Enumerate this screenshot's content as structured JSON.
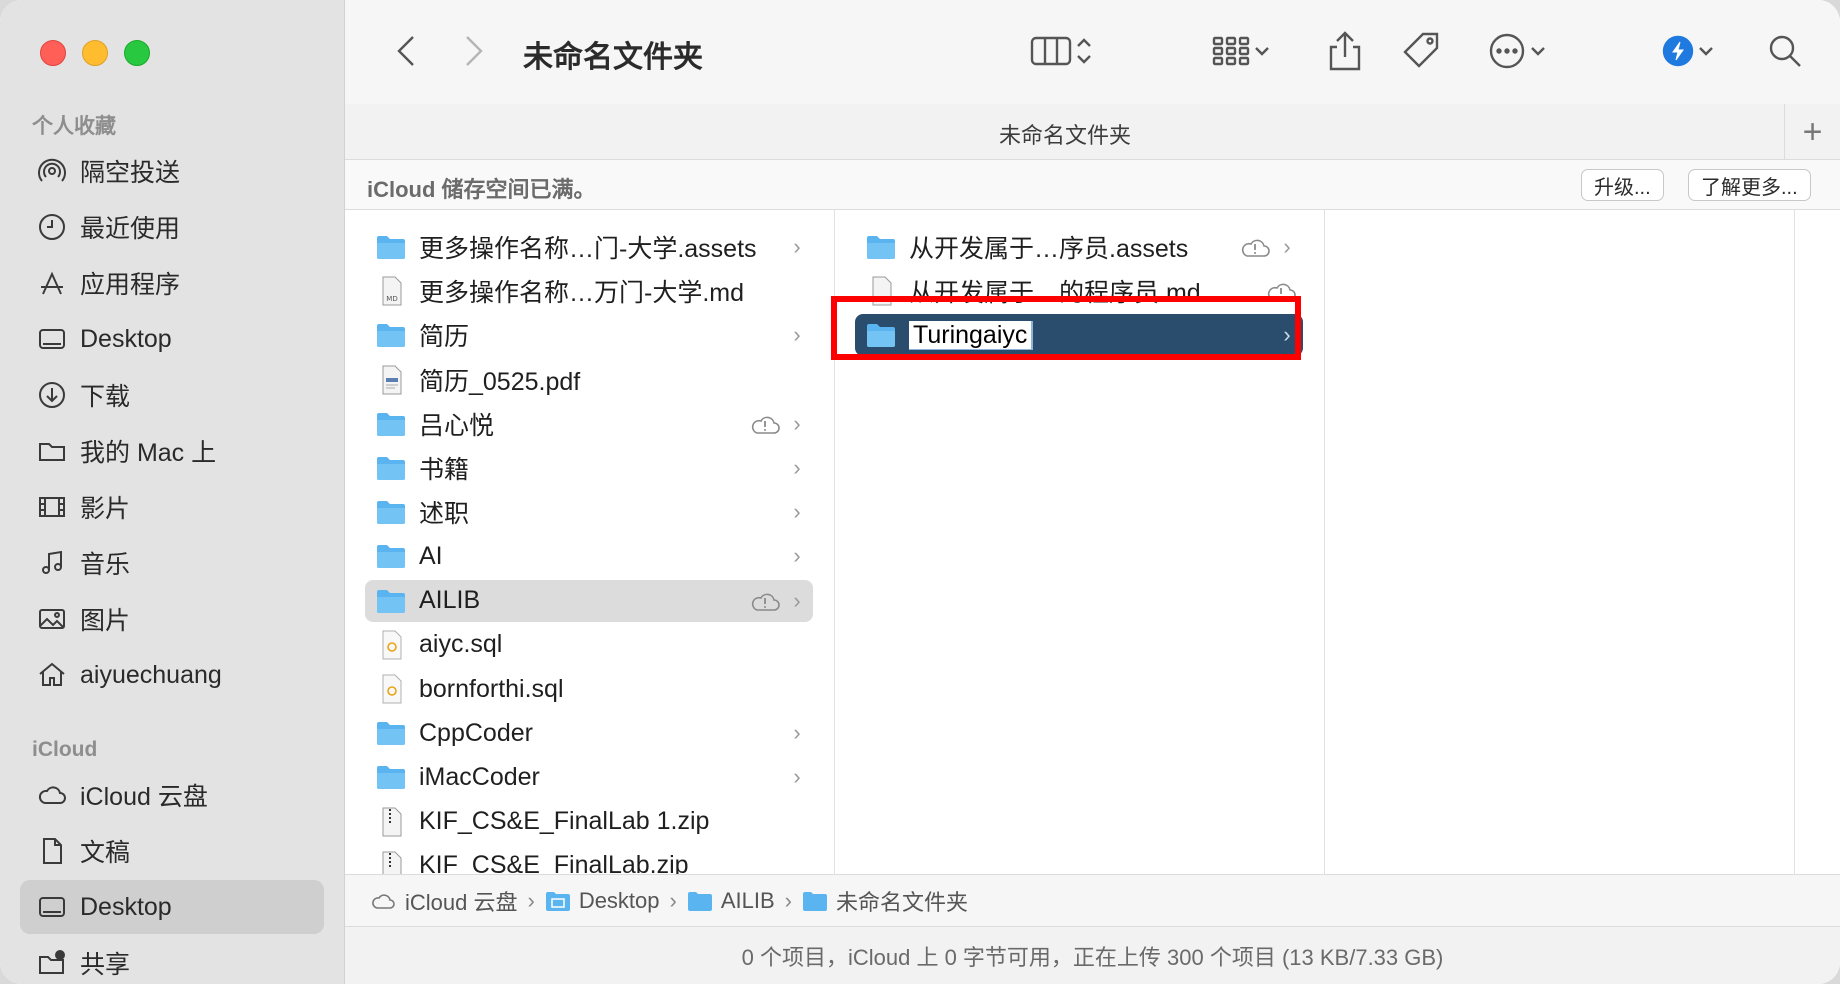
{
  "sidebar": {
    "favorites_title": "个人收藏",
    "favorites": [
      {
        "label": "隔空投送",
        "icon": "airdrop-icon"
      },
      {
        "label": "最近使用",
        "icon": "clock-icon"
      },
      {
        "label": "应用程序",
        "icon": "applications-icon"
      },
      {
        "label": "Desktop",
        "icon": "desktop-icon"
      },
      {
        "label": "下载",
        "icon": "download-icon"
      },
      {
        "label": "我的 Mac 上",
        "icon": "folder-icon"
      },
      {
        "label": "影片",
        "icon": "film-icon"
      },
      {
        "label": "音乐",
        "icon": "music-icon"
      },
      {
        "label": "图片",
        "icon": "photo-icon"
      },
      {
        "label": "aiyuechuang",
        "icon": "home-icon"
      }
    ],
    "icloud_title": "iCloud",
    "icloud": [
      {
        "label": "iCloud 云盘",
        "icon": "cloud-icon"
      },
      {
        "label": "文稿",
        "icon": "document-icon"
      },
      {
        "label": "Desktop",
        "icon": "desktop-icon",
        "selected": true
      },
      {
        "label": "共享",
        "icon": "shared-folder-icon"
      }
    ]
  },
  "toolbar": {
    "title": "未命名文件夹"
  },
  "tab": {
    "label": "未命名文件夹",
    "add_label": "+"
  },
  "banner": {
    "text": "iCloud 储存空间已满。",
    "upgrade_label": "升级...",
    "learn_more_label": "了解更多..."
  },
  "column1": [
    {
      "name": "更多操作名称…门-大学.assets",
      "type": "folder",
      "chevron": true
    },
    {
      "name": "更多操作名称…万门-大学.md",
      "type": "md"
    },
    {
      "name": "简历",
      "type": "folder",
      "chevron": true
    },
    {
      "name": "简历_0525.pdf",
      "type": "pdf"
    },
    {
      "name": "吕心悦",
      "type": "folder",
      "chevron": true,
      "cloud": true
    },
    {
      "name": "书籍",
      "type": "folder",
      "chevron": true
    },
    {
      "name": "述职",
      "type": "folder",
      "chevron": true
    },
    {
      "name": "AI",
      "type": "folder",
      "chevron": true
    },
    {
      "name": "AILIB",
      "type": "folder",
      "chevron": true,
      "cloud": true,
      "selected": true
    },
    {
      "name": "aiyc.sql",
      "type": "sql"
    },
    {
      "name": "bornforthi.sql",
      "type": "sql"
    },
    {
      "name": "CppCoder",
      "type": "folder",
      "chevron": true
    },
    {
      "name": "iMacCoder",
      "type": "folder",
      "chevron": true
    },
    {
      "name": "KIF_CS&E_FinalLab 1.zip",
      "type": "zip"
    },
    {
      "name": "KIF_CS&E_FinalLab.zip",
      "type": "zip"
    }
  ],
  "column2": [
    {
      "name": "从开发属于…序员.assets",
      "type": "folder",
      "chevron": true,
      "cloud": true
    },
    {
      "name": "从开发属于…的程序员.md",
      "type": "md",
      "cloud": true
    },
    {
      "name": "Turingaiyc",
      "type": "folder",
      "chevron": true,
      "selected": true,
      "renaming": true
    }
  ],
  "pathbar": [
    {
      "label": "iCloud 云盘",
      "icon": "cloud-icon"
    },
    {
      "label": "Desktop",
      "icon": "desktop-folder-icon"
    },
    {
      "label": "AILIB",
      "icon": "folder-icon"
    },
    {
      "label": "未命名文件夹",
      "icon": "folder-icon"
    }
  ],
  "status": "0 个项目，iCloud 上 0 字节可用，正在上传 300 个项目 (13 KB/7.33 GB)",
  "colors": {
    "folder": "#5ab4ef",
    "selection_blue": "#2a4d6e",
    "highlight_red": "#ff0000"
  }
}
